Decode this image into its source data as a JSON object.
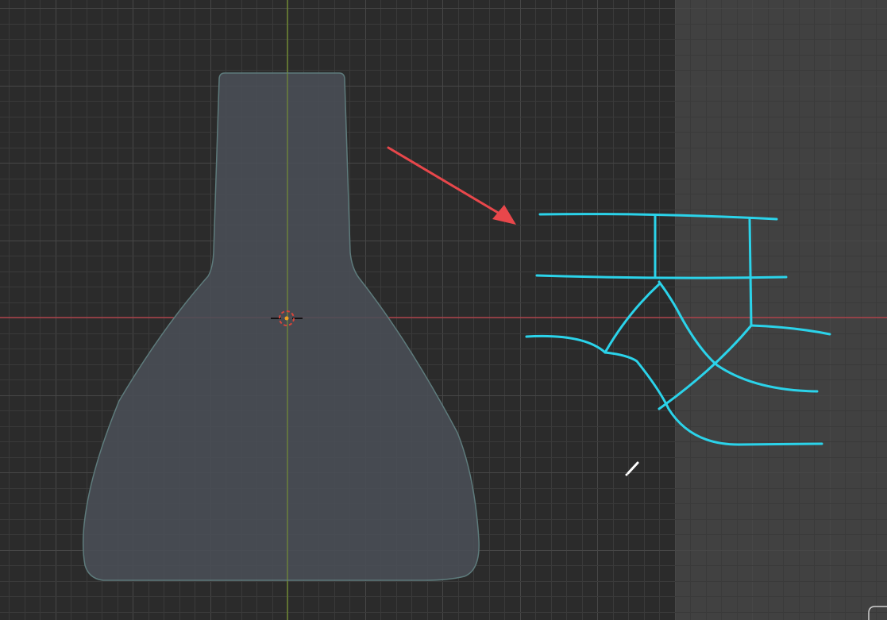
{
  "viewport": {
    "background": "#2b2b2b",
    "right_panel_color": "#414141",
    "grid_minor_color": "#3a3a3a",
    "grid_major_color": "#474747",
    "x_axis_color": "#c2424b",
    "y_axis_color": "#7a9a2e"
  },
  "object": {
    "shape": "flask",
    "fill": "#4a4f56",
    "outline": "#5e7b7c"
  },
  "origin": {
    "icon": "3d-cursor-icon",
    "outer_color": "#ffffff",
    "ring_color": "#d9453a",
    "dot_color": "#f0a020"
  },
  "annotation": {
    "arrow_color": "#e8474b",
    "sketch_color": "#2bd3ea"
  },
  "tool": {
    "icon": "pencil-icon",
    "color": "#ffffff"
  },
  "corner_widget": {
    "icon": "corner-handle-icon"
  }
}
